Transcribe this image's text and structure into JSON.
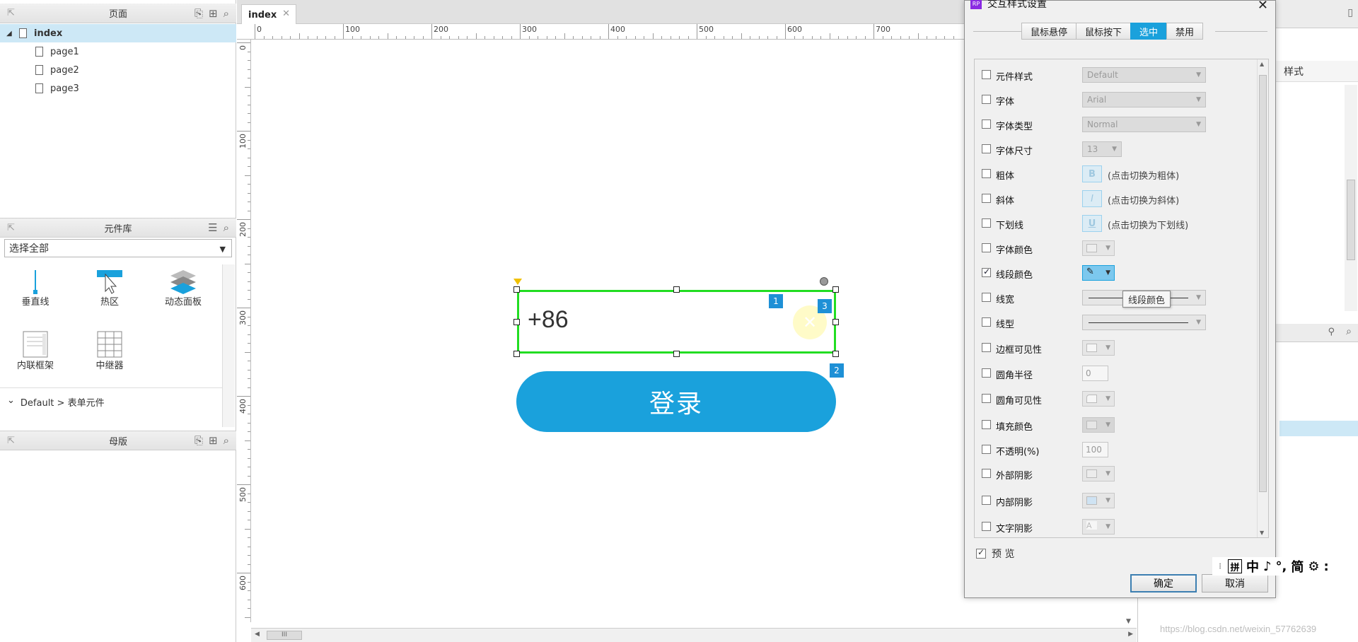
{
  "pages_panel": {
    "title": "页面",
    "items": [
      {
        "label": "index",
        "selected": true
      },
      {
        "label": "page1"
      },
      {
        "label": "page2"
      },
      {
        "label": "page3"
      }
    ]
  },
  "library_panel": {
    "title": "元件库",
    "filter": "选择全部",
    "widgets": [
      "垂直线",
      "热区",
      "动态面板",
      "内联框架",
      "中继器"
    ],
    "section": "Default > 表单元件"
  },
  "masters_panel": {
    "title": "母版"
  },
  "canvas": {
    "tab": "index",
    "ruler_h": [
      "0",
      "100",
      "200",
      "300",
      "400",
      "500",
      "600",
      "700",
      "8"
    ],
    "ruler_v": [
      "0",
      "100",
      "200",
      "300",
      "400",
      "500",
      "600"
    ],
    "input_text": "+86",
    "login_label": "登录",
    "badges": [
      "1",
      "2",
      "3"
    ],
    "scroll_label": "III"
  },
  "right_panel": {
    "style_tab": "样式"
  },
  "dialog": {
    "title": "交互样式设置",
    "tabs": [
      {
        "label": "鼠标悬停"
      },
      {
        "label": "鼠标按下"
      },
      {
        "label": "选中",
        "active": true
      },
      {
        "label": "禁用"
      }
    ],
    "rows": [
      {
        "label": "元件样式",
        "value": "Default"
      },
      {
        "label": "字体",
        "value": "Arial"
      },
      {
        "label": "字体类型",
        "value": "Normal"
      },
      {
        "label": "字体尺寸",
        "value": "13"
      },
      {
        "label": "粗体",
        "hint": "(点击切换为粗体)",
        "icon": "B"
      },
      {
        "label": "斜体",
        "hint": "(点击切换为斜体)",
        "icon": "I"
      },
      {
        "label": "下划线",
        "hint": "(点击切换为下划线)",
        "icon": "U"
      },
      {
        "label": "字体颜色"
      },
      {
        "label": "线段颜色",
        "checked": true
      },
      {
        "label": "线宽"
      },
      {
        "label": "线型"
      },
      {
        "label": "边框可见性"
      },
      {
        "label": "圆角半径",
        "value": "0"
      },
      {
        "label": "圆角可见性"
      },
      {
        "label": "填充颜色"
      },
      {
        "label": "不透明(%)",
        "value": "100"
      },
      {
        "label": "外部阴影"
      },
      {
        "label": "内部阴影"
      },
      {
        "label": "文字阴影"
      }
    ],
    "tooltip": "线段颜色",
    "preview_label": "预 览",
    "ok_label": "确定",
    "cancel_label": "取消"
  },
  "ime": {
    "items": [
      "拼",
      "中",
      "♪",
      "°,",
      "简",
      "⚙",
      ":"
    ]
  },
  "watermark": "https://blog.csdn.net/weixin_57762639"
}
